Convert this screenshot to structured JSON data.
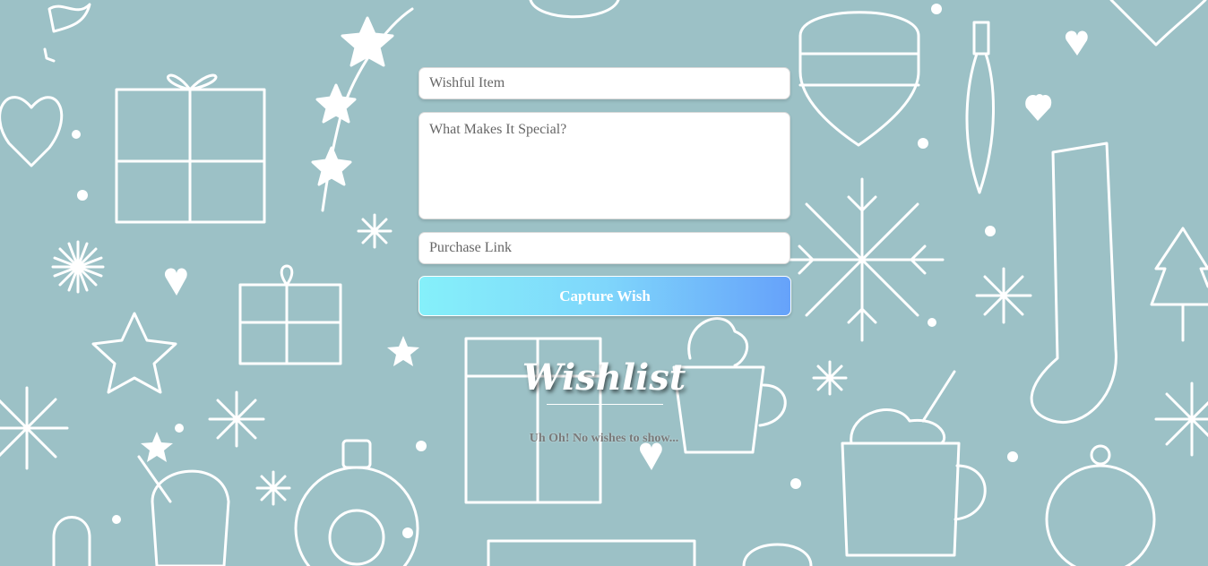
{
  "form": {
    "item_placeholder": "Wishful Item",
    "description_placeholder": "What Makes It Special?",
    "link_placeholder": "Purchase Link",
    "submit_label": "Capture Wish"
  },
  "wishlist": {
    "title": "Wishlist",
    "empty_message": "Uh Oh! No wishes to show..."
  },
  "theme": {
    "background": "#9cc1c6",
    "button_gradient": [
      "#85f0fa",
      "#66a2fa"
    ],
    "pattern": "christmas-doodles"
  }
}
